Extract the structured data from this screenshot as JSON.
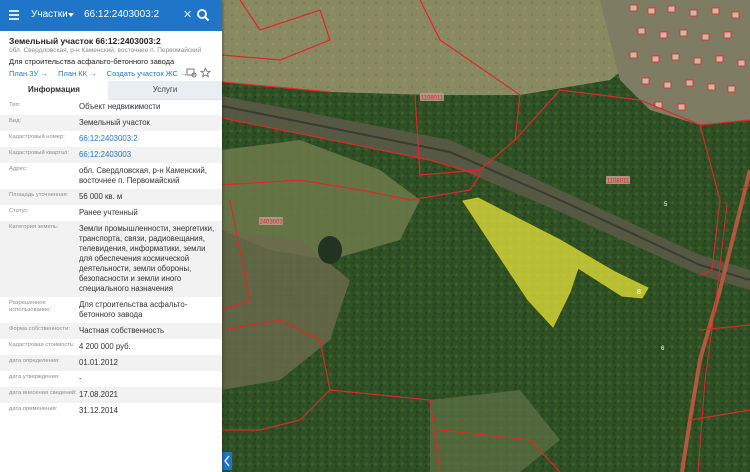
{
  "search": {
    "category": "Участки",
    "query": "66:12:2403003:2"
  },
  "card": {
    "title": "Земельный участок 66:12:2403003:2",
    "address_short": "обл. Свердловская, р-н Каменский, восточнее п. Первомайский",
    "purpose": "Для строительства асфальто-бетонного завода",
    "links": [
      "План ЗУ →",
      "План КК →",
      "Создать участок ЖС →"
    ]
  },
  "tabs": [
    "Информация",
    "Услуги"
  ],
  "info_rows": [
    {
      "key": "Тип:",
      "value": "Объект недвижимости"
    },
    {
      "key": "Вид:",
      "value": "Земельный участок"
    },
    {
      "key": "Кадастровый номер:",
      "value": "66:12:2403003:2",
      "link": true
    },
    {
      "key": "Кадастровый квартал:",
      "value": "66:12:2403003",
      "link": true
    },
    {
      "key": "Адрес:",
      "value": "обл. Свердловская, р-н Каменский, восточнее п. Первомайский"
    },
    {
      "key": "Площадь уточненная:",
      "value": "56 000 кв. м"
    },
    {
      "key": "Статус:",
      "value": "Ранее учтенный"
    },
    {
      "key": "Категория земель:",
      "value": "Земли промышленности, энергетики, транспорта, связи, радиовещания, телевидения, информатики, земли для обеспечения космической деятельности, земли обороны, безопасности и земли иного специального назначения"
    },
    {
      "key": "Разрешенное использование:",
      "value": "Для строительства асфальто-бетонного завода"
    },
    {
      "key": "Форма собственности:",
      "value": "Частная собственность"
    },
    {
      "key": "Кадастровая стоимость:",
      "value": "4 200 000 руб."
    },
    {
      "key": "дата определения:",
      "value": "01.01.2012"
    },
    {
      "key": "дата утверждения:",
      "value": "-"
    },
    {
      "key": "дата внесения сведений:",
      "value": "17.08.2021"
    },
    {
      "key": "дата применения:",
      "value": "31.12.2014"
    }
  ],
  "map": {
    "quarter_labels": [
      "1108011",
      "1108011",
      "2403003"
    ],
    "parcel_label": "8",
    "parcel_fill": "#e7e43a",
    "boundary_color": "#e0262b",
    "number_glyphs": [
      "5",
      "6"
    ]
  },
  "colors": {
    "accent": "#1f76c9"
  }
}
